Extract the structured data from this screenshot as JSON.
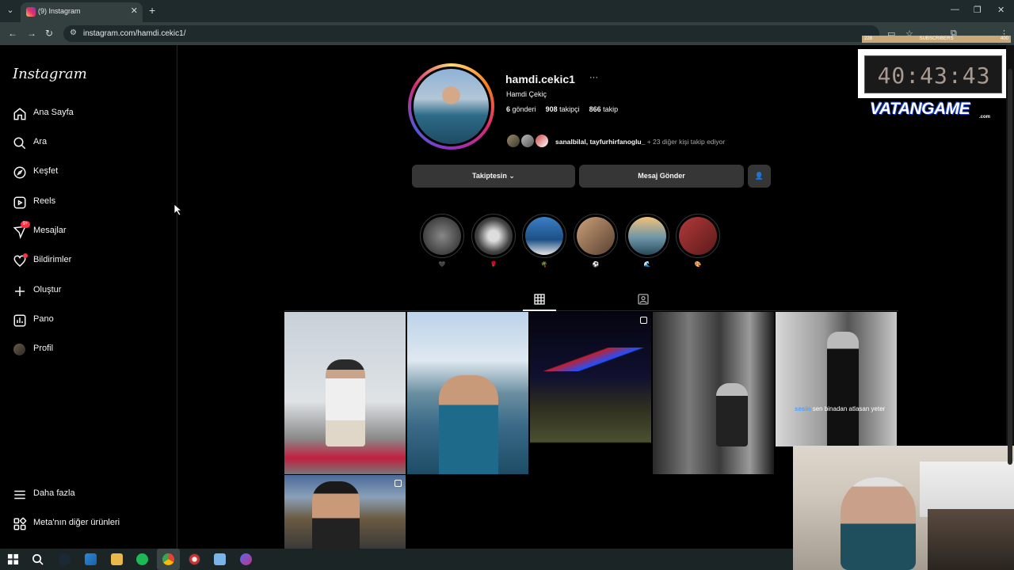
{
  "browser": {
    "tab_title": "(9) Instagram",
    "url": "instagram.com/hamdi.cekic1/"
  },
  "sidebar": {
    "logo": "Instagram",
    "items": [
      {
        "label": "Ana Sayfa",
        "icon": "home-icon"
      },
      {
        "label": "Ara",
        "icon": "search-icon"
      },
      {
        "label": "Keşfet",
        "icon": "compass-icon"
      },
      {
        "label": "Reels",
        "icon": "reels-icon"
      },
      {
        "label": "Mesajlar",
        "icon": "messenger-icon",
        "badge": "9+"
      },
      {
        "label": "Bildirimler",
        "icon": "heart-icon"
      },
      {
        "label": "Oluştur",
        "icon": "plus-icon"
      },
      {
        "label": "Pano",
        "icon": "dashboard-icon"
      },
      {
        "label": "Profil",
        "icon": "avatar-icon"
      }
    ],
    "bottom": [
      {
        "label": "Daha fazla",
        "icon": "menu-icon"
      },
      {
        "label": "Meta'nın diğer ürünleri",
        "icon": "apps-icon"
      }
    ]
  },
  "profile": {
    "username": "hamdi.cekic1",
    "more": "···",
    "full_name": "Hamdi Çekiç",
    "posts_count": "6",
    "posts_label": "gönderi",
    "followers_count": "908",
    "followers_label": "takipçi",
    "following_count": "866",
    "following_label": "takip",
    "mutual_names": "sanalbilal, tayfurhirfanoglu_",
    "mutual_rest": " + 23 diğer kişi takip ediyor",
    "following_button": "Takiptesin",
    "message_button": "Mesaj Gönder"
  },
  "highlights": [
    {
      "label": "🖤",
      "color": "#444"
    },
    {
      "label": "🌹",
      "color": "#5a4a3a"
    },
    {
      "label": "🌴",
      "color": "#3c7fb8"
    },
    {
      "label": "⚽",
      "color": "#6a5040"
    },
    {
      "label": "🌊",
      "color": "#8aa0b0"
    },
    {
      "label": "🎨",
      "color": "#8b2020"
    }
  ],
  "overlay": {
    "timer": "40:43:43",
    "subs_left": "228",
    "subs_label": "SUBSCRIBERS",
    "subs_right": "400",
    "brand": "VATANGAME",
    "brand_sub": ".com",
    "chat_user": "sesin",
    "chat_message": " sen binadan atlasan yeter"
  },
  "taskbar_icons": [
    "windows-icon",
    "search-icon",
    "steam-icon",
    "store-icon",
    "folder-icon",
    "spotify-icon",
    "chrome-icon",
    "app-icon",
    "notepad-icon",
    "discord-icon"
  ]
}
